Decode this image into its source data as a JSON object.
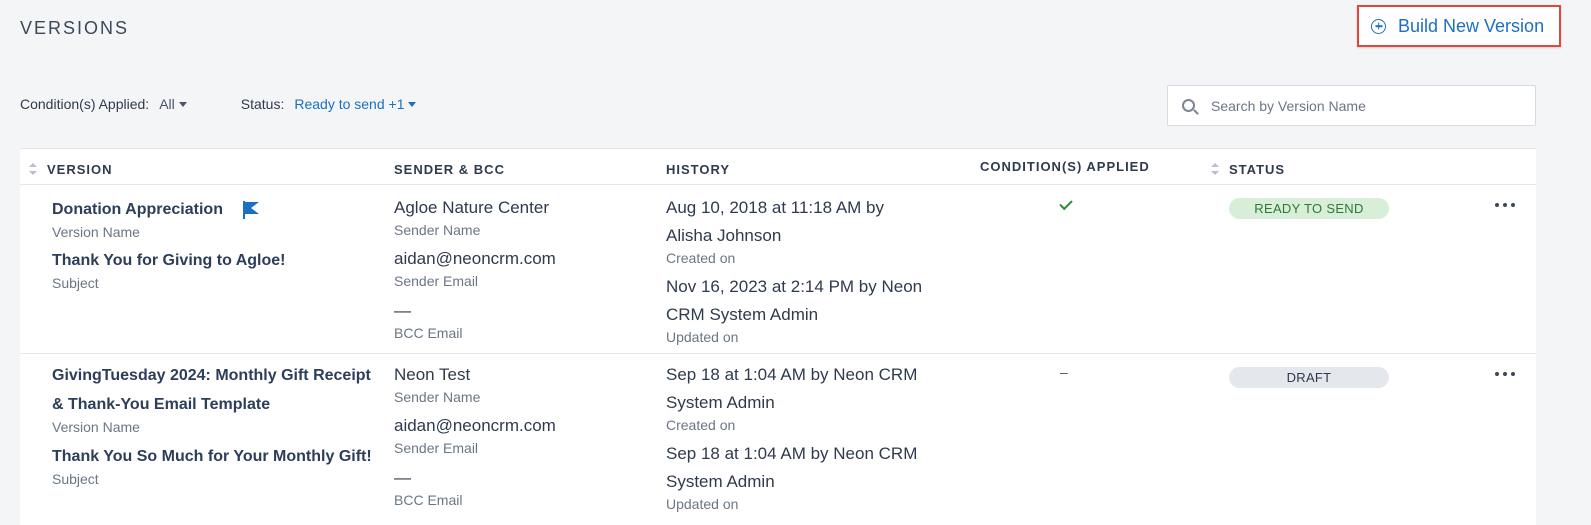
{
  "header": {
    "title": "VERSIONS",
    "build_button_label": "Build New Version"
  },
  "filters": {
    "conditions_label": "Condition(s) Applied:",
    "conditions_value": "All",
    "status_label": "Status:",
    "status_value": "Ready to send +1"
  },
  "search": {
    "placeholder": "Search by Version Name",
    "value": ""
  },
  "table": {
    "columns": {
      "version": "VERSION",
      "sender": "SENDER & BCC",
      "history": "HISTORY",
      "conditions": "CONDITION(S) APPLIED",
      "status": "STATUS"
    },
    "rows": [
      {
        "version_name": "Donation Appreciation",
        "version_name_caption": "Version Name",
        "subject": "Thank You for Giving to Agloe!",
        "subject_caption": "Subject",
        "sender_name": "Agloe Nature Center",
        "sender_name_caption": "Sender Name",
        "sender_email": "aidan@neoncrm.com",
        "sender_email_caption": "Sender Email",
        "bcc_email": "—",
        "bcc_email_caption": "BCC Email",
        "created_line1": "Aug 10, 2018 at 11:18 AM by",
        "created_line2": "Alisha Johnson",
        "created_caption": "Created on",
        "updated_line1": "Nov 16, 2023 at 2:14 PM by Neon",
        "updated_line2": "CRM System Admin",
        "updated_caption": "Updated on",
        "conditions_applied": true,
        "status": "READY TO SEND",
        "flagged": true
      },
      {
        "version_name_line1": "GivingTuesday 2024: Monthly Gift Receipt",
        "version_name_line2": "& Thank-You Email Template",
        "version_name_caption": "Version Name",
        "subject": "Thank You So Much for Your Monthly Gift!",
        "subject_caption": "Subject",
        "sender_name": "Neon Test",
        "sender_name_caption": "Sender Name",
        "sender_email": "aidan@neoncrm.com",
        "sender_email_caption": "Sender Email",
        "bcc_email": "—",
        "bcc_email_caption": "BCC Email",
        "created_line1": "Sep 18 at 1:04 AM by Neon CRM",
        "created_line2": "System Admin",
        "created_caption": "Created on",
        "updated_line1": "Sep 18 at 1:04 AM by Neon CRM",
        "updated_line2": "System Admin",
        "updated_caption": "Updated on",
        "conditions_applied_text": "–",
        "status": "DRAFT",
        "flagged": false
      }
    ]
  },
  "colors": {
    "accent": "#1d6fc4",
    "highlight_border": "#e0463b",
    "ready_bg": "#d9eed8",
    "ready_text": "#2c7a32",
    "draft_bg": "#e4e7ec"
  },
  "icons": [
    "plus-circle-icon",
    "caret-down-icon",
    "search-icon",
    "sort-icon",
    "flag-icon",
    "check-icon",
    "more-options-icon"
  ]
}
